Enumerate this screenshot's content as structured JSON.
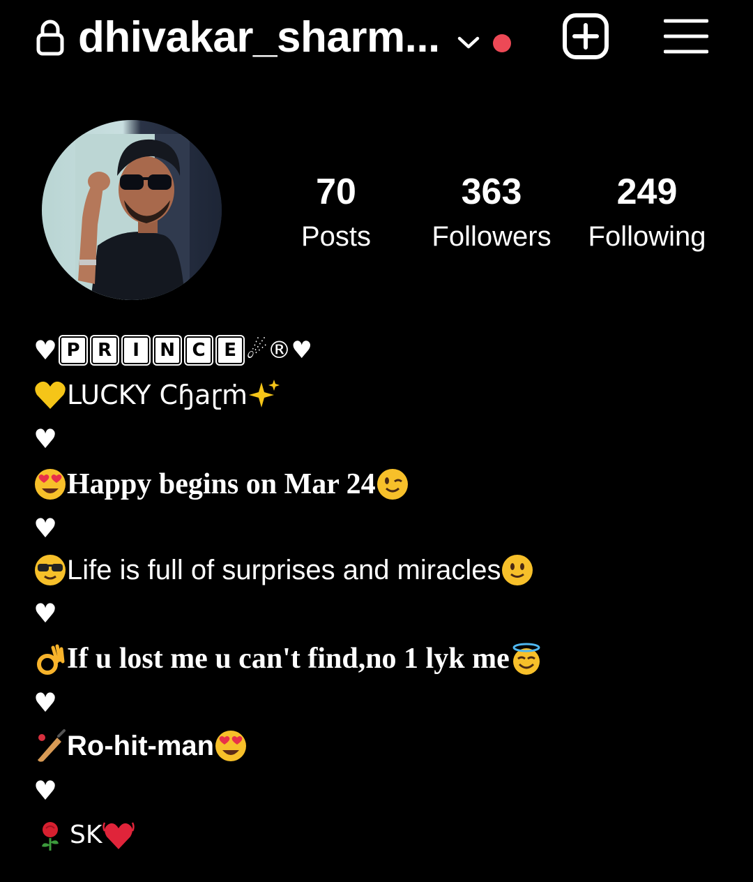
{
  "header": {
    "username": "dhivakar_sharm...",
    "lock_icon": "lock-icon",
    "dropdown_icon": "chevron-down-icon",
    "notification_color": "#ed4956",
    "new_post_icon": "plus-square-icon",
    "menu_icon": "hamburger-menu-icon"
  },
  "profile": {
    "avatar": "profile-photo",
    "stats": [
      {
        "value": "70",
        "label": "Posts"
      },
      {
        "value": "363",
        "label": "Followers"
      },
      {
        "value": "249",
        "label": "Following"
      }
    ]
  },
  "bio": {
    "line1": {
      "prefix": "♥",
      "letters": [
        "P",
        "R",
        "I",
        "N",
        "C",
        "E"
      ],
      "suffix": "☄®♥"
    },
    "line2": "LUCKY Cɧaɽṁ",
    "line3": "♥",
    "line4": "Happy begins on Mar 24",
    "line5": "♥",
    "line6": "Life is full of surprises and miracles",
    "line7": "♥",
    "line8": "If u lost me u can't find,no 1 lyk me",
    "line9": "♥",
    "line10": "Ro-hit-man",
    "line11": "♥",
    "line12": "SK"
  }
}
